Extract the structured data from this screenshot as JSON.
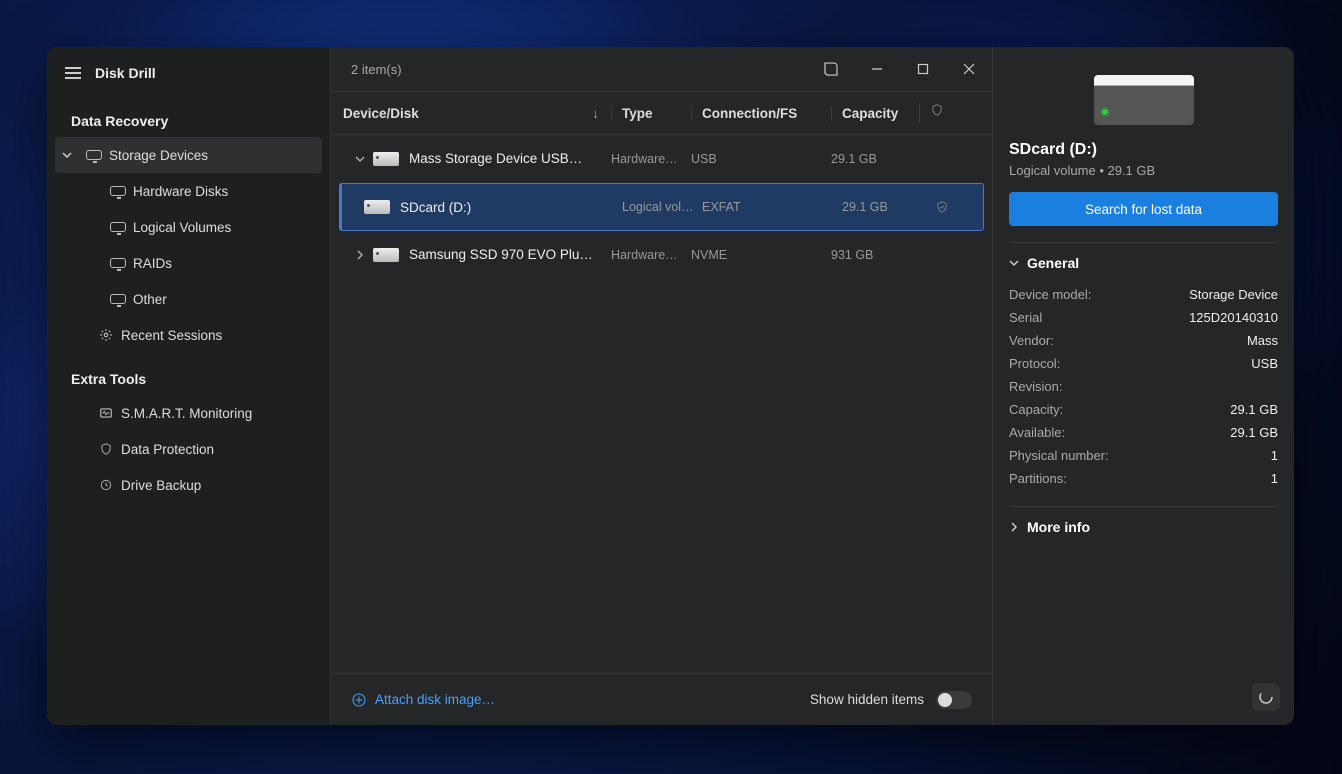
{
  "app": {
    "title": "Disk Drill"
  },
  "sidebar": {
    "sections": {
      "recovery_head": "Data Recovery",
      "extra_head": "Extra Tools"
    },
    "items": {
      "storage": "Storage Devices",
      "hardware": "Hardware Disks",
      "logical": "Logical Volumes",
      "raids": "RAIDs",
      "other": "Other",
      "recent": "Recent Sessions",
      "smart": "S.M.A.R.T. Monitoring",
      "dataprot": "Data Protection",
      "backup": "Drive Backup"
    }
  },
  "header": {
    "count": "2 item(s)"
  },
  "columns": {
    "device": "Device/Disk",
    "type": "Type",
    "conn": "Connection/FS",
    "cap": "Capacity"
  },
  "rows": [
    {
      "name": "Mass Storage Device USB…",
      "type": "Hardware…",
      "conn": "USB",
      "cap": "29.1 GB"
    },
    {
      "name": "SDcard (D:)",
      "type": "Logical vol…",
      "conn": "EXFAT",
      "cap": "29.1 GB"
    },
    {
      "name": "Samsung SSD 970 EVO Plu…",
      "type": "Hardware…",
      "conn": "NVME",
      "cap": "931 GB"
    }
  ],
  "footer": {
    "attach": "Attach disk image…",
    "show_hidden": "Show hidden items"
  },
  "details": {
    "title": "SDcard (D:)",
    "sub": "Logical volume • 29.1 GB",
    "action": "Search for lost data",
    "general_label": "General",
    "moreinfo_label": "More info",
    "general": {
      "device_model_k": "Device model:",
      "device_model_v": "Storage Device",
      "serial_k": "Serial",
      "serial_v": "125D20140310",
      "vendor_k": "Vendor:",
      "vendor_v": "Mass",
      "protocol_k": "Protocol:",
      "protocol_v": "USB",
      "revision_k": "Revision:",
      "revision_v": "",
      "capacity_k": "Capacity:",
      "capacity_v": "29.1 GB",
      "available_k": "Available:",
      "available_v": "29.1 GB",
      "physnum_k": "Physical number:",
      "physnum_v": "1",
      "partitions_k": "Partitions:",
      "partitions_v": "1"
    }
  }
}
